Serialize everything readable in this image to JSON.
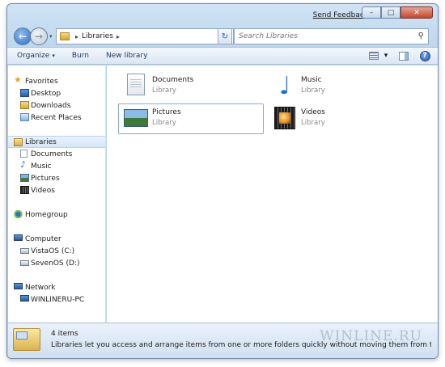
{
  "titlebar": {
    "send_feedback": "Send Feedback",
    "minimize": "–",
    "maximize": "□",
    "close": "✕"
  },
  "address": {
    "chevron": "▸",
    "path": "Libraries",
    "after_chevron": "▸",
    "dropdown": "▾",
    "refresh": "↻"
  },
  "search": {
    "placeholder": "Search Libraries"
  },
  "toolbar": {
    "organize": "Organize",
    "burn": "Burn",
    "new_library": "New library",
    "caret": "▾"
  },
  "nav_pane": {
    "favorites": {
      "label": "Favorites",
      "items": [
        "Desktop",
        "Downloads",
        "Recent Places"
      ]
    },
    "libraries": {
      "label": "Libraries",
      "items": [
        "Documents",
        "Music",
        "Pictures",
        "Videos"
      ]
    },
    "homegroup": "Homegroup",
    "computer": {
      "label": "Computer",
      "items": [
        "VistaOS (C:)",
        "SevenOS (D:)"
      ]
    },
    "network": {
      "label": "Network",
      "items": [
        "WINLINERU-PC"
      ]
    }
  },
  "libraries": [
    {
      "name": "Documents",
      "sub": "Library",
      "icon": "documents-icon"
    },
    {
      "name": "Music",
      "sub": "Library",
      "icon": "music-icon"
    },
    {
      "name": "Pictures",
      "sub": "Library",
      "icon": "pictures-icon"
    },
    {
      "name": "Videos",
      "sub": "Library",
      "icon": "videos-icon"
    }
  ],
  "statusbar": {
    "count": "4 items",
    "description": "Libraries let you access and arrange items from one or more folders quickly without moving them from their original lo...",
    "watermark": "WINLINE.RU"
  },
  "colors": {
    "accent": "#2f6fc0",
    "frame": "#bcd5ec",
    "selection": "#d4e6f8"
  }
}
